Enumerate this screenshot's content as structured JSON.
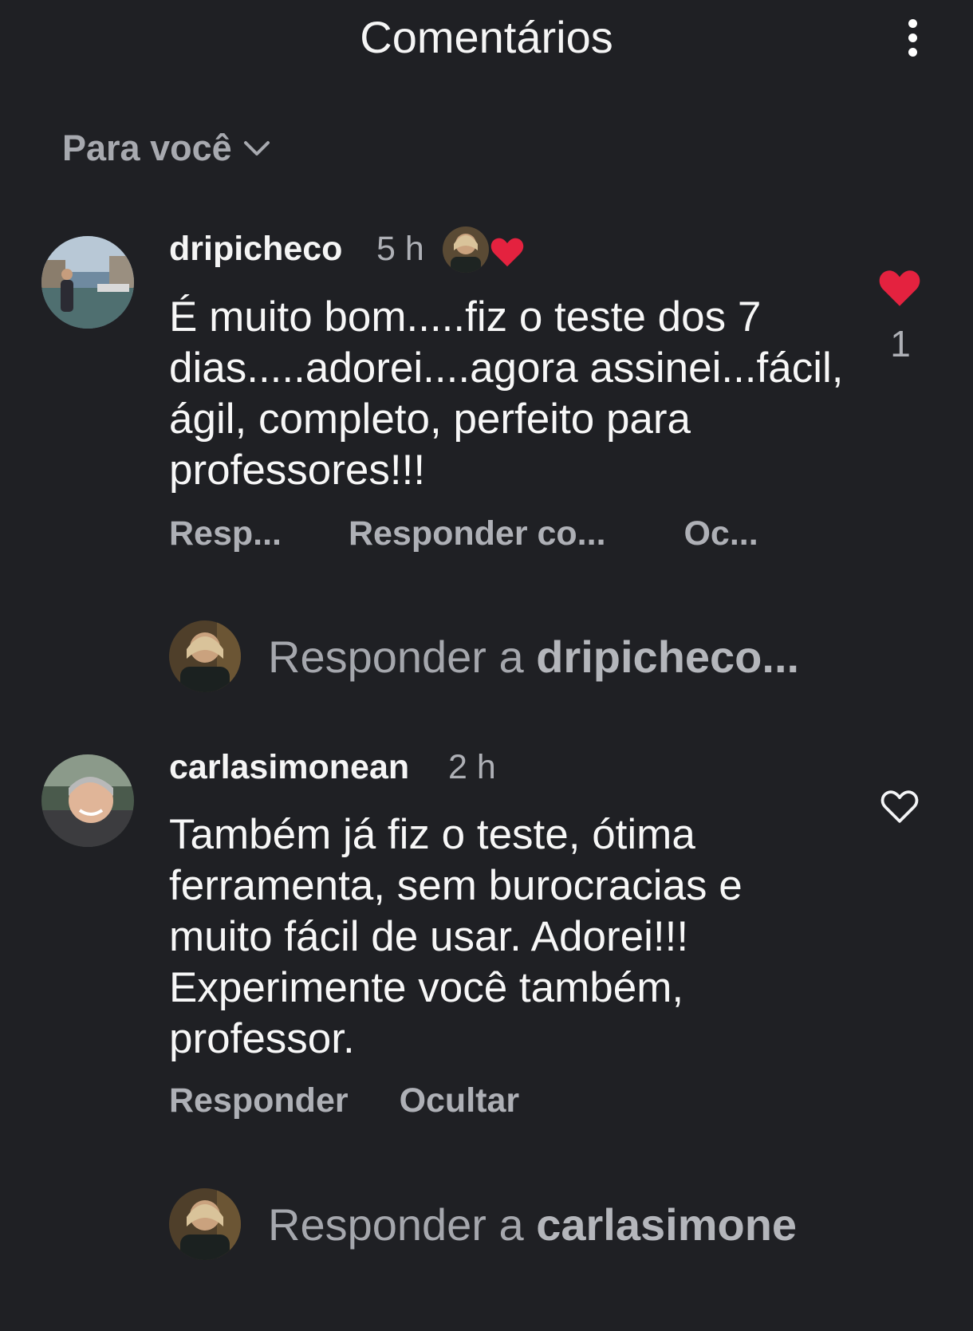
{
  "header": {
    "title": "Comentários"
  },
  "filter": {
    "label": "Para você"
  },
  "comments": [
    {
      "username": "dripicheco",
      "time": "5 h",
      "text": "É muito bom.....fiz o teste dos 7 dias.....adorei....agora assinei...fácil, ágil, completo, perfeito para professores!!!",
      "actions": [
        "Resp...",
        "Responder co...",
        "Oc..."
      ],
      "likes": "1",
      "liked": true,
      "reply_prefix": "Responder a ",
      "reply_name": "dripicheco..."
    },
    {
      "username": "carlasimonean",
      "time": "2 h",
      "text": "Também já fiz o teste, ótima ferramenta, sem burocracias e muito fácil de usar. Adorei!!! Experimente você também, professor.",
      "actions": [
        "Responder",
        "Ocultar"
      ],
      "likes": "",
      "liked": false,
      "reply_prefix": "Responder a ",
      "reply_name": "carlasimone"
    }
  ],
  "colors": {
    "background": "#1f2024",
    "heart": "#e4223f",
    "muted": "#aeb0b6"
  },
  "icons": [
    "more-vertical-icon",
    "chevron-down-icon",
    "heart-filled-icon",
    "heart-outline-icon"
  ]
}
